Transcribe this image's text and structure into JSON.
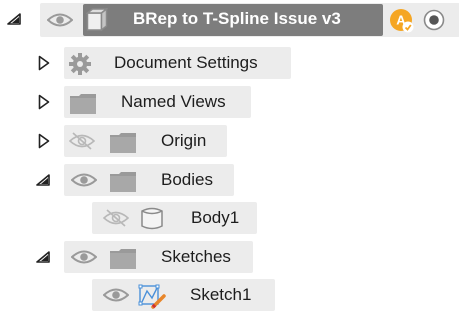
{
  "browser": {
    "root": {
      "label": "BRep to T-Spline Issue v3",
      "badge_letter": "A",
      "badge_color": "#f5a623",
      "icons": [
        "collapse-triangle-icon",
        "eye-icon",
        "component-icon",
        "user-badge-icon",
        "radio-target-icon"
      ]
    },
    "items": [
      {
        "label": "Document Settings",
        "icons": [
          "expand-triangle-icon",
          "gear-icon"
        ]
      },
      {
        "label": "Named Views",
        "icons": [
          "expand-triangle-icon",
          "folder-icon"
        ]
      },
      {
        "label": "Origin",
        "visible": false,
        "icons": [
          "expand-triangle-icon",
          "eye-hidden-icon",
          "folder-icon"
        ]
      },
      {
        "label": "Bodies",
        "visible": true,
        "icons": [
          "collapse-triangle-icon",
          "eye-icon",
          "folder-icon"
        ]
      },
      {
        "label": "Body1",
        "visible": false,
        "icons": [
          "eye-hidden-icon",
          "body-icon"
        ]
      },
      {
        "label": "Sketches",
        "visible": true,
        "icons": [
          "collapse-triangle-icon",
          "eye-icon",
          "folder-icon"
        ]
      },
      {
        "label": "Sketch1",
        "visible": true,
        "icons": [
          "eye-icon",
          "sketch-icon"
        ]
      }
    ]
  }
}
